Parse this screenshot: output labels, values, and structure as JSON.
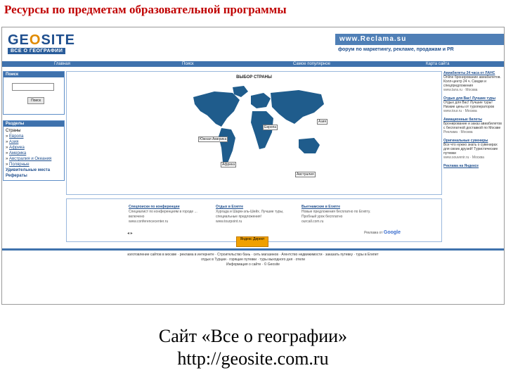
{
  "slide": {
    "title": "Ресурсы по предметам образовательной программы",
    "caption_line1": "Сайт «Все о географии»",
    "caption_line2": "http://geosite.com.ru"
  },
  "site": {
    "logo_word_left": "GE",
    "logo_word_o": "O",
    "logo_word_right": "SITE",
    "logo_sub": "ВСЕ О ГЕОГРАФИИ",
    "banner_top": "www.Reclama.su",
    "banner_bottom": "форум по маркетингу, рекламе, продажам и PR"
  },
  "nav": {
    "items": [
      "Главная",
      "Поиск",
      "Самое популярное",
      "Карта сайта"
    ]
  },
  "left": {
    "search_head": "Поиск",
    "search_button": "Поиск",
    "sections_head": "Разделы",
    "countries_label": "Страны",
    "countries": [
      "Европа",
      "Азия",
      "Африка",
      "Америка",
      "Австралия и Океания",
      "Полярные"
    ],
    "bold_items": [
      "Удивительные места",
      "Рефераты"
    ]
  },
  "center": {
    "map_title": "ВЫБОР СТРАНЫ",
    "map_labels": {
      "europe": "Европа",
      "asia": "Азия",
      "africa": "Африка",
      "south_america": "Южная Америка",
      "australia": "Австралия"
    },
    "results": [
      {
        "title": "Спецпоиски по конференции",
        "desc": "Специалист по конференциям в городе ... включено",
        "url": "www.conferencecenter.ru"
      },
      {
        "title": "Отдых в Египте",
        "desc": "Хургада и Шарм-эль-Шейх. Лучшие туры, специальные предложения!",
        "url": "www.tourpoint.ru"
      },
      {
        "title": "Вьетнамские в Египте",
        "desc": "Новые предложения бесплатно по Египту. Пробный урок бесплатно",
        "url": "ourcall.com.ru"
      }
    ],
    "ads_by": "Реклама от",
    "google": "Google"
  },
  "right": {
    "ads": [
      {
        "title": "Авиабилеты 24 часа от ЛАНС",
        "desc": "Online бронирование авиабилетов. Колл-центр 24 ч. Скидки и спецпредложения",
        "url": "www.lans.ru · Москва"
      },
      {
        "title": "Отдых для Вас! Лучшие туры",
        "desc": "Отдых для Вас! Лучшие туры! Низкие цены от туроператоров",
        "url": "www.tour.ru · Москва"
      },
      {
        "title": "Авиационные билеты",
        "desc": "Бронирование и заказ авиабилетов с бесплатной доставкой по Москве",
        "url": "Реклама · Москва"
      },
      {
        "title": "Оригинальные сувениры",
        "desc": "Все что нужно знать о сувенирах для своих друзей! Туристические путевки",
        "url": "www.souvenir.ru · Москва"
      },
      {
        "title": "Реклама на Яндексе",
        "desc": "",
        "url": ""
      }
    ]
  },
  "orange_button": "Яндекс Директ",
  "footer": {
    "line1": "изготовление сайтов в москве · реклама в интернете · Строительство бань · сеть магазинов · Агентство недвижимости · заказать путевку · туры в Египет",
    "line2": "отдых в Турции · горящие путевки · туры выходного дня · отели",
    "line3": "Информация о сайте · © Geosite"
  }
}
